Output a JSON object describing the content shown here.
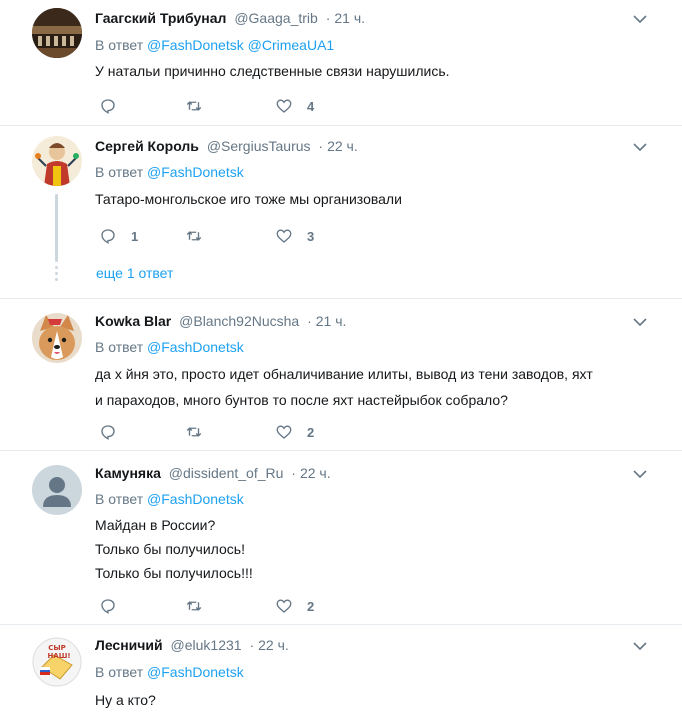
{
  "reply_prefix": "В ответ",
  "tweets": [
    {
      "name": "Гаагский Трибунал",
      "handle": "@Gaaga_trib",
      "dot": "·",
      "time": "21 ч.",
      "mentions": [
        "@FashDonetsk",
        "@CrimeaUA1"
      ],
      "lines": [
        "У натальи причинно следственные связи нарушились."
      ],
      "replies": "",
      "retweets": "",
      "likes": "4"
    },
    {
      "name": "Сергей Король",
      "handle": "@SergiusTaurus",
      "dot": "·",
      "time": "22 ч.",
      "mentions": [
        "@FashDonetsk"
      ],
      "lines": [
        "Татаро-монгольское иго тоже мы организовали"
      ],
      "replies": "1",
      "retweets": "",
      "likes": "3",
      "more_replies": "еще 1 ответ"
    },
    {
      "name": "Kowka Blar",
      "handle": "@Blanch92Nucsha",
      "dot": "·",
      "time": "21 ч.",
      "mentions": [
        "@FashDonetsk"
      ],
      "lines": [
        "да х  йня это, просто идет обналичивание илиты, вывод из тени заводов, яхт",
        "и параходов, много бунтов то после яхт настейрыбок собрало?"
      ],
      "replies": "",
      "retweets": "",
      "likes": "2"
    },
    {
      "name": "Камуняка",
      "handle": "@dissident_of_Ru",
      "dot": "·",
      "time": "22 ч.",
      "mentions": [
        "@FashDonetsk"
      ],
      "lines": [
        "Майдан в России?",
        "Только бы получилось!",
        "Только бы получилось!!!"
      ],
      "replies": "",
      "retweets": "",
      "likes": "2"
    },
    {
      "name": "Лесничий",
      "handle": "@eluk1231",
      "dot": "·",
      "time": "22 ч.",
      "mentions": [
        "@FashDonetsk"
      ],
      "lines": [
        "Ну а кто?"
      ],
      "avatar_text": [
        "СЫР",
        "НАШ!"
      ]
    }
  ],
  "colors": {
    "link": "#1da1f2",
    "muted": "#657786",
    "text": "#14171a",
    "divider": "#e6ecf0"
  },
  "icons": [
    "reply-icon",
    "retweet-icon",
    "like-icon",
    "chevron-down-icon"
  ]
}
